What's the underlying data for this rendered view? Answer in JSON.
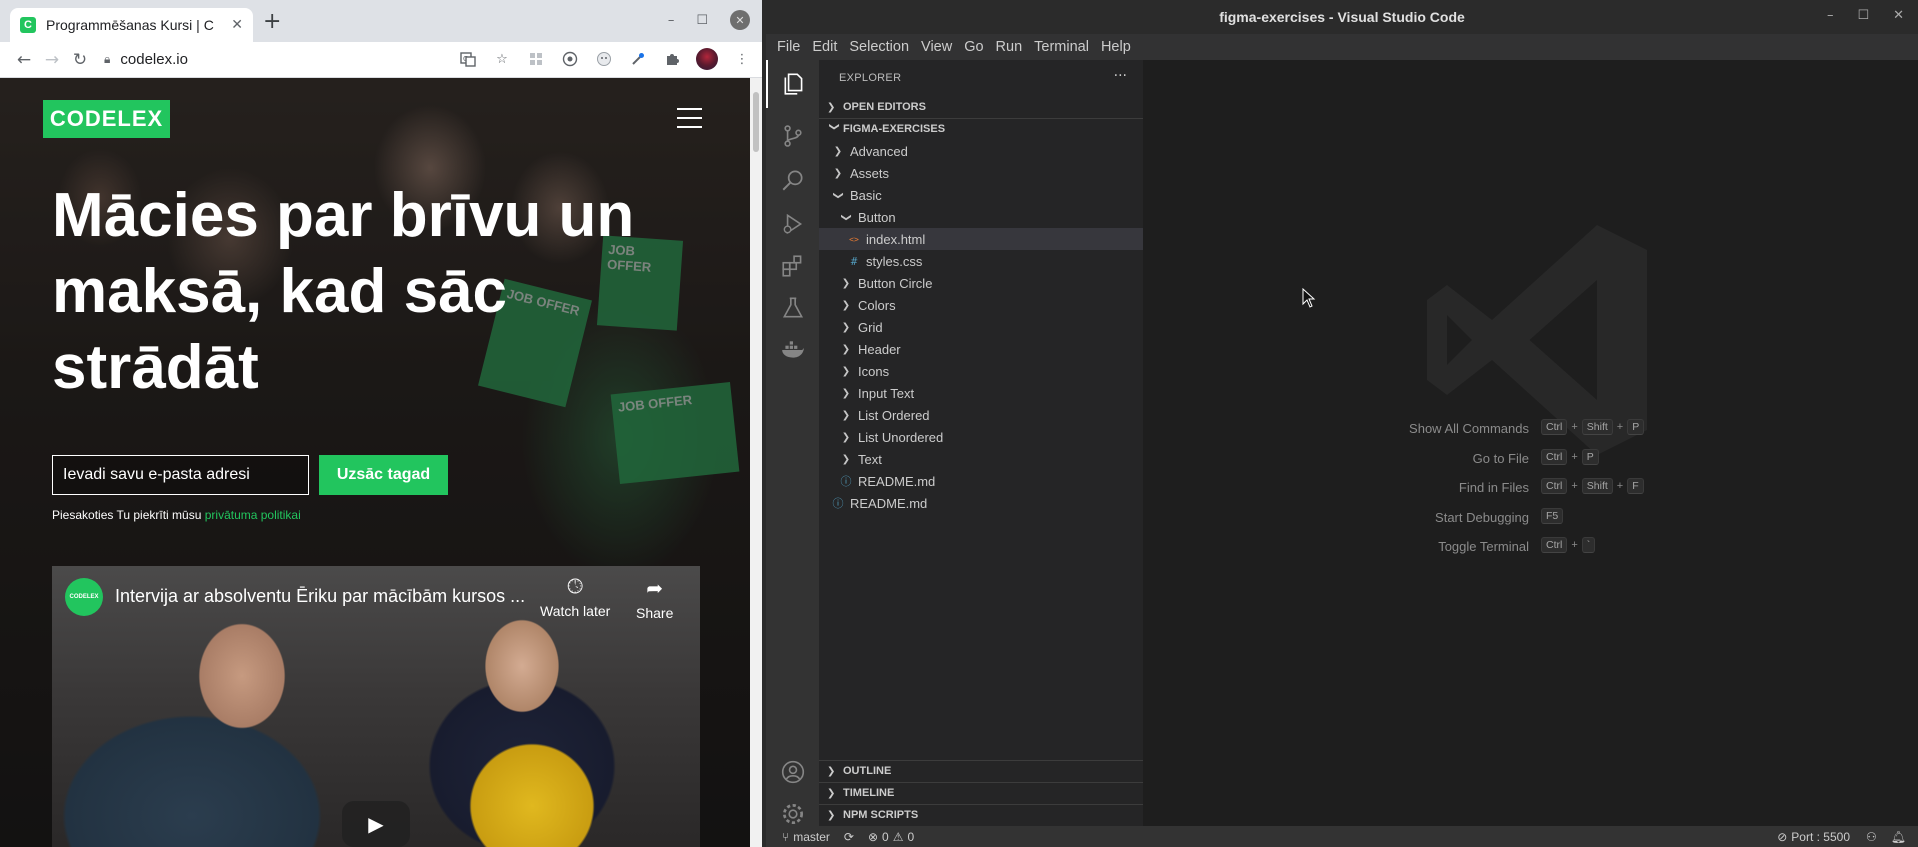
{
  "chrome": {
    "tab_title": "Programmēšanas Kursi | C",
    "tab_favicon_letter": "C",
    "url": "codelex.io",
    "icons": [
      "back-icon",
      "forward-icon",
      "reload-icon",
      "lock-icon",
      "translate-icon",
      "star-icon",
      "extensions-icon",
      "menu-icon"
    ]
  },
  "site": {
    "logo": "CODELEX",
    "hero_title": "Mācies par brīvu un maksā, kad sāc strādāt",
    "email_placeholder": "Ievadi savu e-pasta adresi",
    "cta": "Uzsāc tagad",
    "consent_text": "Piesakoties Tu piekrīti mūsu ",
    "consent_link": "privātuma politikai",
    "signs": [
      "JOB OFFER",
      "JOB OFFER",
      "JOB OFFER"
    ],
    "video": {
      "channel": "CODELEX",
      "title": "Intervija ar absolventu Ēriku par mācībām kursos ...",
      "watch_later": "Watch later",
      "share": "Share"
    }
  },
  "vscode": {
    "window_title": "figma-exercises - Visual Studio Code",
    "menu": [
      "File",
      "Edit",
      "Selection",
      "View",
      "Go",
      "Run",
      "Terminal",
      "Help"
    ],
    "explorer_title": "EXPLORER",
    "open_editors": "OPEN EDITORS",
    "project": "FIGMA-EXERCISES",
    "tree": [
      {
        "label": "Advanced",
        "type": "folder",
        "open": false,
        "depth": 1
      },
      {
        "label": "Assets",
        "type": "folder",
        "open": false,
        "depth": 1
      },
      {
        "label": "Basic",
        "type": "folder",
        "open": true,
        "depth": 1
      },
      {
        "label": "Button",
        "type": "folder",
        "open": true,
        "depth": 2
      },
      {
        "label": "index.html",
        "type": "html",
        "depth": 3,
        "selected": true
      },
      {
        "label": "styles.css",
        "type": "css",
        "depth": 3
      },
      {
        "label": "Button Circle",
        "type": "folder",
        "open": false,
        "depth": 2
      },
      {
        "label": "Colors",
        "type": "folder",
        "open": false,
        "depth": 2
      },
      {
        "label": "Grid",
        "type": "folder",
        "open": false,
        "depth": 2
      },
      {
        "label": "Header",
        "type": "folder",
        "open": false,
        "depth": 2
      },
      {
        "label": "Icons",
        "type": "folder",
        "open": false,
        "depth": 2
      },
      {
        "label": "Input Text",
        "type": "folder",
        "open": false,
        "depth": 2
      },
      {
        "label": "List Ordered",
        "type": "folder",
        "open": false,
        "depth": 2
      },
      {
        "label": "List Unordered",
        "type": "folder",
        "open": false,
        "depth": 2
      },
      {
        "label": "Text",
        "type": "folder",
        "open": false,
        "depth": 2
      },
      {
        "label": "README.md",
        "type": "md",
        "depth": 2
      },
      {
        "label": "README.md",
        "type": "md",
        "depth": 1
      }
    ],
    "bottom_sections": [
      "OUTLINE",
      "TIMELINE",
      "NPM SCRIPTS"
    ],
    "shortcuts": [
      {
        "label": "Show All Commands",
        "keys": [
          "Ctrl",
          "Shift",
          "P"
        ]
      },
      {
        "label": "Go to File",
        "keys": [
          "Ctrl",
          "P"
        ]
      },
      {
        "label": "Find in Files",
        "keys": [
          "Ctrl",
          "Shift",
          "F"
        ]
      },
      {
        "label": "Start Debugging",
        "keys": [
          "F5"
        ]
      },
      {
        "label": "Toggle Terminal",
        "keys": [
          "Ctrl",
          "`"
        ]
      }
    ],
    "status": {
      "branch": "master",
      "errors": "0",
      "warnings": "0",
      "port": "Port : 5500"
    },
    "colors": {
      "accent_green": "#22c55e",
      "editor_bg": "#1e1e1e",
      "sidebar_bg": "#252526"
    }
  }
}
